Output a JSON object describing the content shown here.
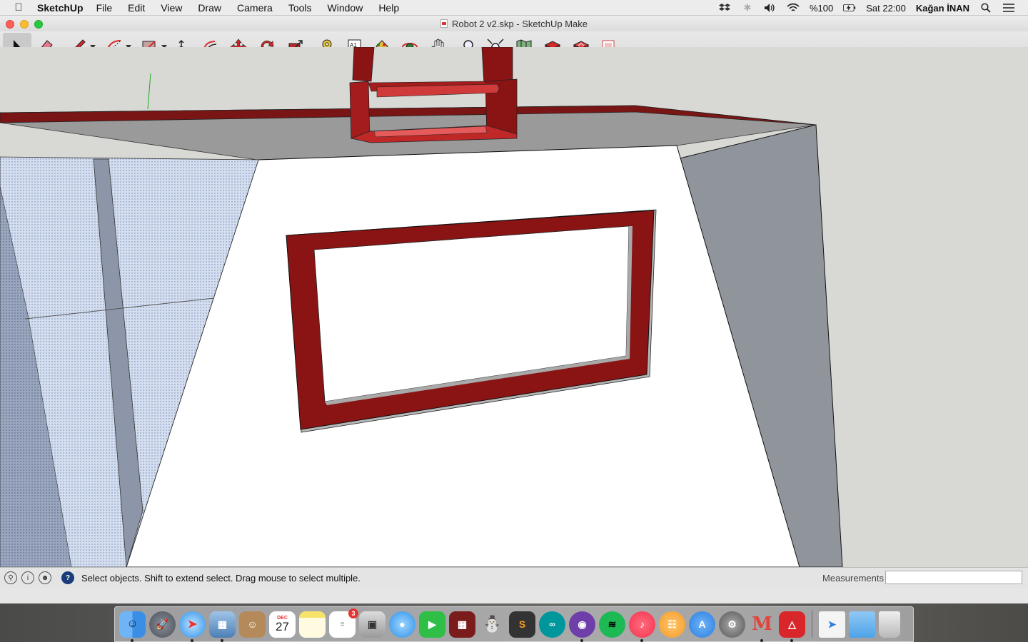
{
  "menubar": {
    "app_name": "SketchUp",
    "items": [
      "File",
      "Edit",
      "View",
      "Draw",
      "Camera",
      "Tools",
      "Window",
      "Help"
    ],
    "battery": "%100",
    "clock": "Sat 22:00",
    "user": "Kağan İNAN"
  },
  "window": {
    "title": "Robot 2 v2.skp - SketchUp Make"
  },
  "toolbar": {
    "tools": [
      "select-tool",
      "eraser-tool",
      "pencil-tool",
      "arc-tool",
      "rectangle-tool",
      "push-pull-tool",
      "offset-tool",
      "move-tool",
      "rotate-tool",
      "scale-tool",
      "tape-measure-tool",
      "text-tool",
      "paint-bucket-tool",
      "orbit-tool",
      "pan-tool",
      "zoom-tool",
      "zoom-extents-tool",
      "warehouse-tool",
      "extension-warehouse-tool",
      "share-model-tool",
      "layout-tool"
    ],
    "text_tool_label": "A1"
  },
  "status": {
    "message": "Select objects. Shift to extend select. Drag mouse to select multiple.",
    "measurements_label": "Measurements",
    "measurements_value": ""
  },
  "dock": {
    "apps": [
      "Finder",
      "Launchpad",
      "Safari",
      "Preview",
      "Contacts",
      "Calendar",
      "Notes",
      "Reminders",
      "Photo Booth",
      "Messages",
      "FaceTime",
      "Photos",
      "Android File Transfer",
      "Sublime Text",
      "Arduino",
      "GitHub",
      "Spotify",
      "iTunes",
      "iBooks",
      "App Store",
      "System Preferences",
      "Mendeley",
      "SketchUp",
      "Downloads",
      "Documents",
      "Trash"
    ],
    "calendar_month": "DEC",
    "calendar_day": "27",
    "reminders_badge": "3",
    "sublime_label": "S",
    "colors": {
      "finder": "#3a8ee6",
      "safari": "#2a8fe8",
      "spotify": "#1db954",
      "itunes": "#f5324c",
      "ibooks": "#f59b26",
      "appstore": "#2a7de1",
      "sketchup": "#d9262b"
    }
  }
}
